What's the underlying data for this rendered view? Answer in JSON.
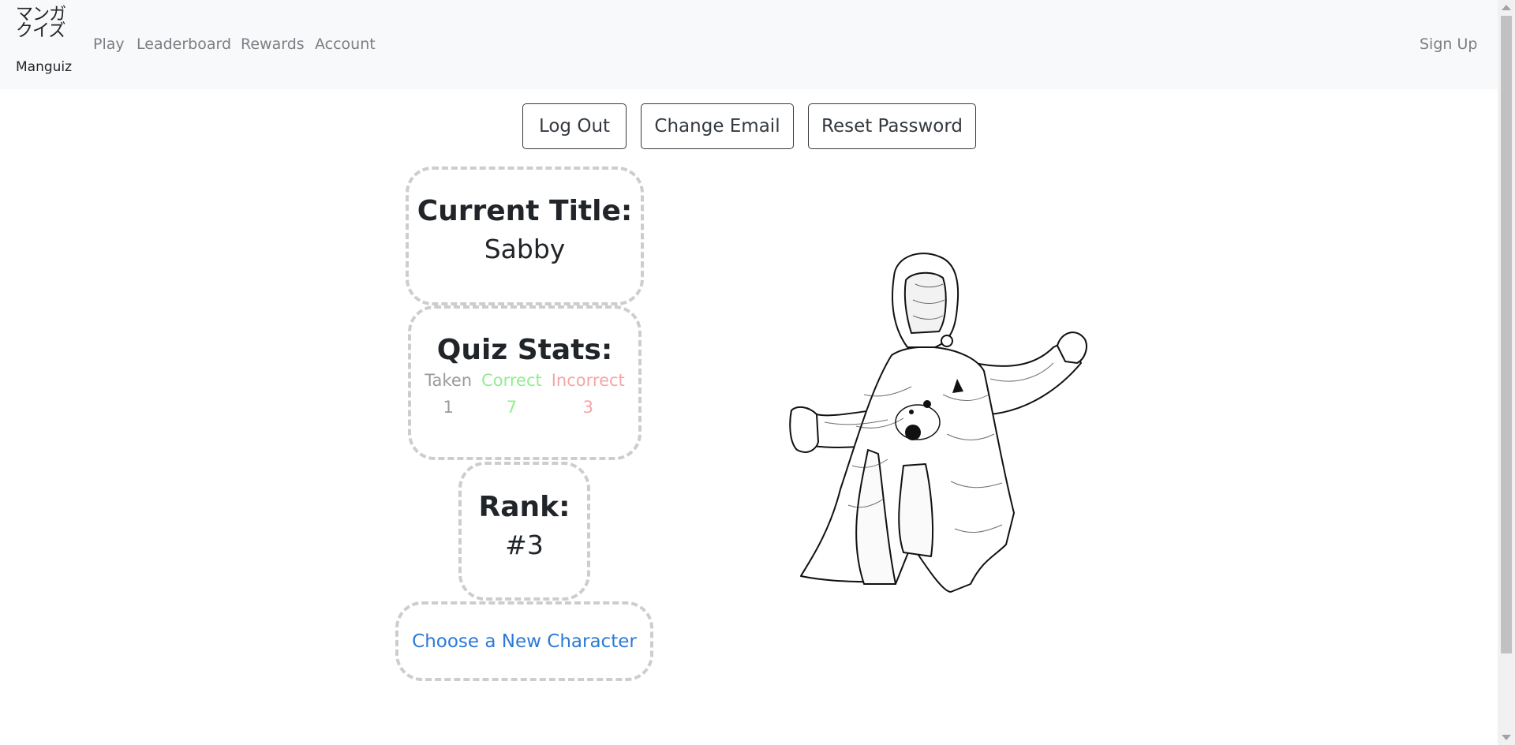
{
  "nav": {
    "brand_jp_line1": "マンガ",
    "brand_jp_line2": "クイズ",
    "brand_en": "Manguiz",
    "links": {
      "play": "Play",
      "leaderboard": "Leaderboard",
      "rewards": "Rewards",
      "account": "Account"
    },
    "sign_up": "Sign Up"
  },
  "actions": {
    "log_out": "Log Out",
    "change_email": "Change Email",
    "reset_password": "Reset Password"
  },
  "title_card": {
    "heading": "Current Title:",
    "value": "Sabby"
  },
  "stats_card": {
    "heading": "Quiz Stats:",
    "taken_label": "Taken",
    "taken_value": "1",
    "correct_label": "Correct",
    "correct_value": "7",
    "incorrect_label": "Incorrect",
    "incorrect_value": "3",
    "colors": {
      "taken": "#9a9a9a",
      "correct": "#90ee90",
      "incorrect": "#f4a6a6"
    }
  },
  "rank_card": {
    "heading": "Rank:",
    "value": "#3"
  },
  "choose_character": {
    "label": "Choose a New Character",
    "color": "#2a7ad8"
  },
  "character_image": {
    "icon": "hooded-character-illustration"
  }
}
